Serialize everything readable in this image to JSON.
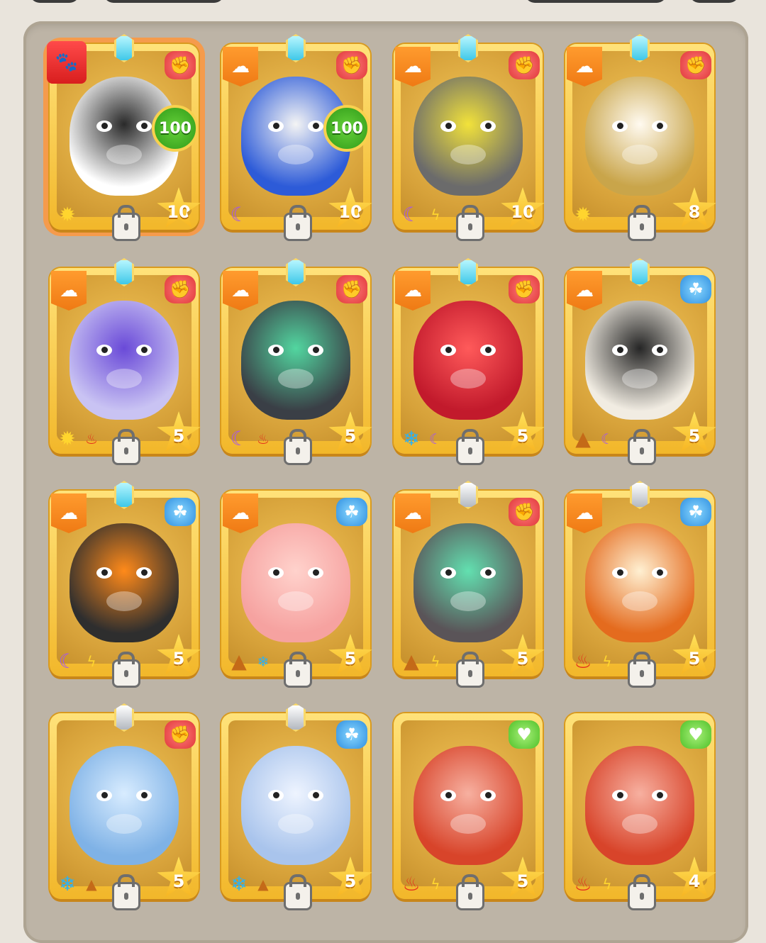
{
  "colors": {
    "card_gold": "#f2b72a",
    "panel_bg": "#bdb4a6",
    "selected_glow": "#ff963c",
    "level_green": "#2f9a18"
  },
  "cards": [
    {
      "role_icon": "paw-icon",
      "role_symbol": "🐾",
      "pinned": true,
      "gem": "cyan",
      "type_icon": "red",
      "level": "100",
      "stars": "10",
      "traits": [
        "sun-trait-icon"
      ],
      "trait_glyphs": [
        "✹"
      ],
      "creature": "panda",
      "selected": true
    },
    {
      "role_icon": "chef-hat-icon",
      "role_symbol": "☁",
      "pinned": false,
      "gem": "cyan",
      "type_icon": "red",
      "level": "100",
      "stars": "10",
      "traits": [
        "moon-trait-icon"
      ],
      "trait_glyphs": [
        "☾"
      ],
      "creature": "blue-masked-rabbit",
      "selected": false
    },
    {
      "role_icon": "chef-hat-icon",
      "role_symbol": "☁",
      "pinned": false,
      "gem": "cyan",
      "type_icon": "red",
      "level": "",
      "stars": "10",
      "traits": [
        "moon-trait-icon",
        "lightning-trait-icon"
      ],
      "trait_glyphs": [
        "☾",
        "ϟ"
      ],
      "creature": "thunder-dragon",
      "selected": false
    },
    {
      "role_icon": "chef-hat-icon",
      "role_symbol": "☁",
      "pinned": false,
      "gem": "cyan",
      "type_icon": "red",
      "level": "",
      "stars": "8",
      "traits": [
        "sun-trait-icon"
      ],
      "trait_glyphs": [
        "✹"
      ],
      "creature": "straw-hat-rabbit",
      "selected": false
    },
    {
      "role_icon": "chef-hat-icon",
      "role_symbol": "☁",
      "pinned": false,
      "gem": "cyan",
      "type_icon": "red",
      "level": "",
      "stars": "5",
      "traits": [
        "sun-trait-icon",
        "fire-trait-icon"
      ],
      "trait_glyphs": [
        "✹",
        "♨"
      ],
      "creature": "purple-wolf",
      "selected": false
    },
    {
      "role_icon": "chef-hat-icon",
      "role_symbol": "☁",
      "pinned": false,
      "gem": "cyan",
      "type_icon": "red",
      "level": "",
      "stars": "5",
      "traits": [
        "moon-trait-icon",
        "fire-trait-icon"
      ],
      "trait_glyphs": [
        "☾",
        "♨"
      ],
      "creature": "dark-wolf",
      "selected": false
    },
    {
      "role_icon": "chef-hat-icon",
      "role_symbol": "☁",
      "pinned": false,
      "gem": "cyan",
      "type_icon": "red",
      "level": "",
      "stars": "5",
      "traits": [
        "ice-trait-icon",
        "moon-trait-icon"
      ],
      "trait_glyphs": [
        "❄",
        "☾"
      ],
      "creature": "red-dragon",
      "selected": false
    },
    {
      "role_icon": "chef-hat-icon",
      "role_symbol": "☁",
      "pinned": false,
      "gem": "cyan",
      "type_icon": "blue",
      "level": "",
      "stars": "5",
      "traits": [
        "earth-trait-icon",
        "moon-trait-icon"
      ],
      "trait_glyphs": [
        "▲",
        "☾"
      ],
      "creature": "black-panda",
      "selected": false
    },
    {
      "role_icon": "chef-hat-icon",
      "role_symbol": "☁",
      "pinned": false,
      "gem": "cyan",
      "type_icon": "blue",
      "level": "",
      "stars": "5",
      "traits": [
        "moon-trait-icon",
        "lightning-trait-icon"
      ],
      "trait_glyphs": [
        "☾",
        "ϟ"
      ],
      "creature": "lava-dragon",
      "selected": false
    },
    {
      "role_icon": "chef-hat-icon",
      "role_symbol": "☁",
      "pinned": false,
      "gem": "none",
      "type_icon": "blue",
      "level": "",
      "stars": "5",
      "traits": [
        "earth-trait-icon",
        "ice-trait-icon"
      ],
      "trait_glyphs": [
        "▲",
        "❄"
      ],
      "creature": "pink-pig",
      "selected": false
    },
    {
      "role_icon": "chef-hat-icon",
      "role_symbol": "☁",
      "pinned": false,
      "gem": "silver",
      "type_icon": "red",
      "level": "",
      "stars": "5",
      "traits": [
        "earth-trait-icon",
        "lightning-trait-icon"
      ],
      "trait_glyphs": [
        "▲",
        "ϟ"
      ],
      "creature": "gray-dragon",
      "selected": false
    },
    {
      "role_icon": "chef-hat-icon",
      "role_symbol": "☁",
      "pinned": false,
      "gem": "silver",
      "type_icon": "blue",
      "level": "",
      "stars": "5",
      "traits": [
        "fire-trait-icon",
        "lightning-trait-icon"
      ],
      "trait_glyphs": [
        "♨",
        "ϟ"
      ],
      "creature": "fire-fox",
      "selected": false
    },
    {
      "role_icon": "none",
      "role_symbol": "",
      "pinned": false,
      "gem": "silver",
      "type_icon": "red",
      "level": "",
      "stars": "5",
      "traits": [
        "ice-trait-icon",
        "earth-trait-icon"
      ],
      "trait_glyphs": [
        "❄",
        "▲"
      ],
      "creature": "ice-dragon",
      "selected": false
    },
    {
      "role_icon": "none",
      "role_symbol": "",
      "pinned": false,
      "gem": "silver",
      "type_icon": "blue",
      "level": "",
      "stars": "5",
      "traits": [
        "ice-trait-icon",
        "earth-trait-icon"
      ],
      "trait_glyphs": [
        "❄",
        "▲"
      ],
      "creature": "ice-bear",
      "selected": false
    },
    {
      "role_icon": "none",
      "role_symbol": "",
      "pinned": false,
      "gem": "none",
      "type_icon": "green",
      "level": "",
      "stars": "5",
      "traits": [
        "fire-trait-icon",
        "lightning-trait-icon"
      ],
      "trait_glyphs": [
        "♨",
        "ϟ"
      ],
      "creature": "red-boar",
      "selected": false
    },
    {
      "role_icon": "none",
      "role_symbol": "",
      "pinned": false,
      "gem": "none",
      "type_icon": "green",
      "level": "",
      "stars": "4",
      "traits": [
        "fire-trait-icon",
        "lightning-trait-icon"
      ],
      "trait_glyphs": [
        "♨",
        "ϟ"
      ],
      "creature": "red-boar",
      "selected": false
    }
  ]
}
